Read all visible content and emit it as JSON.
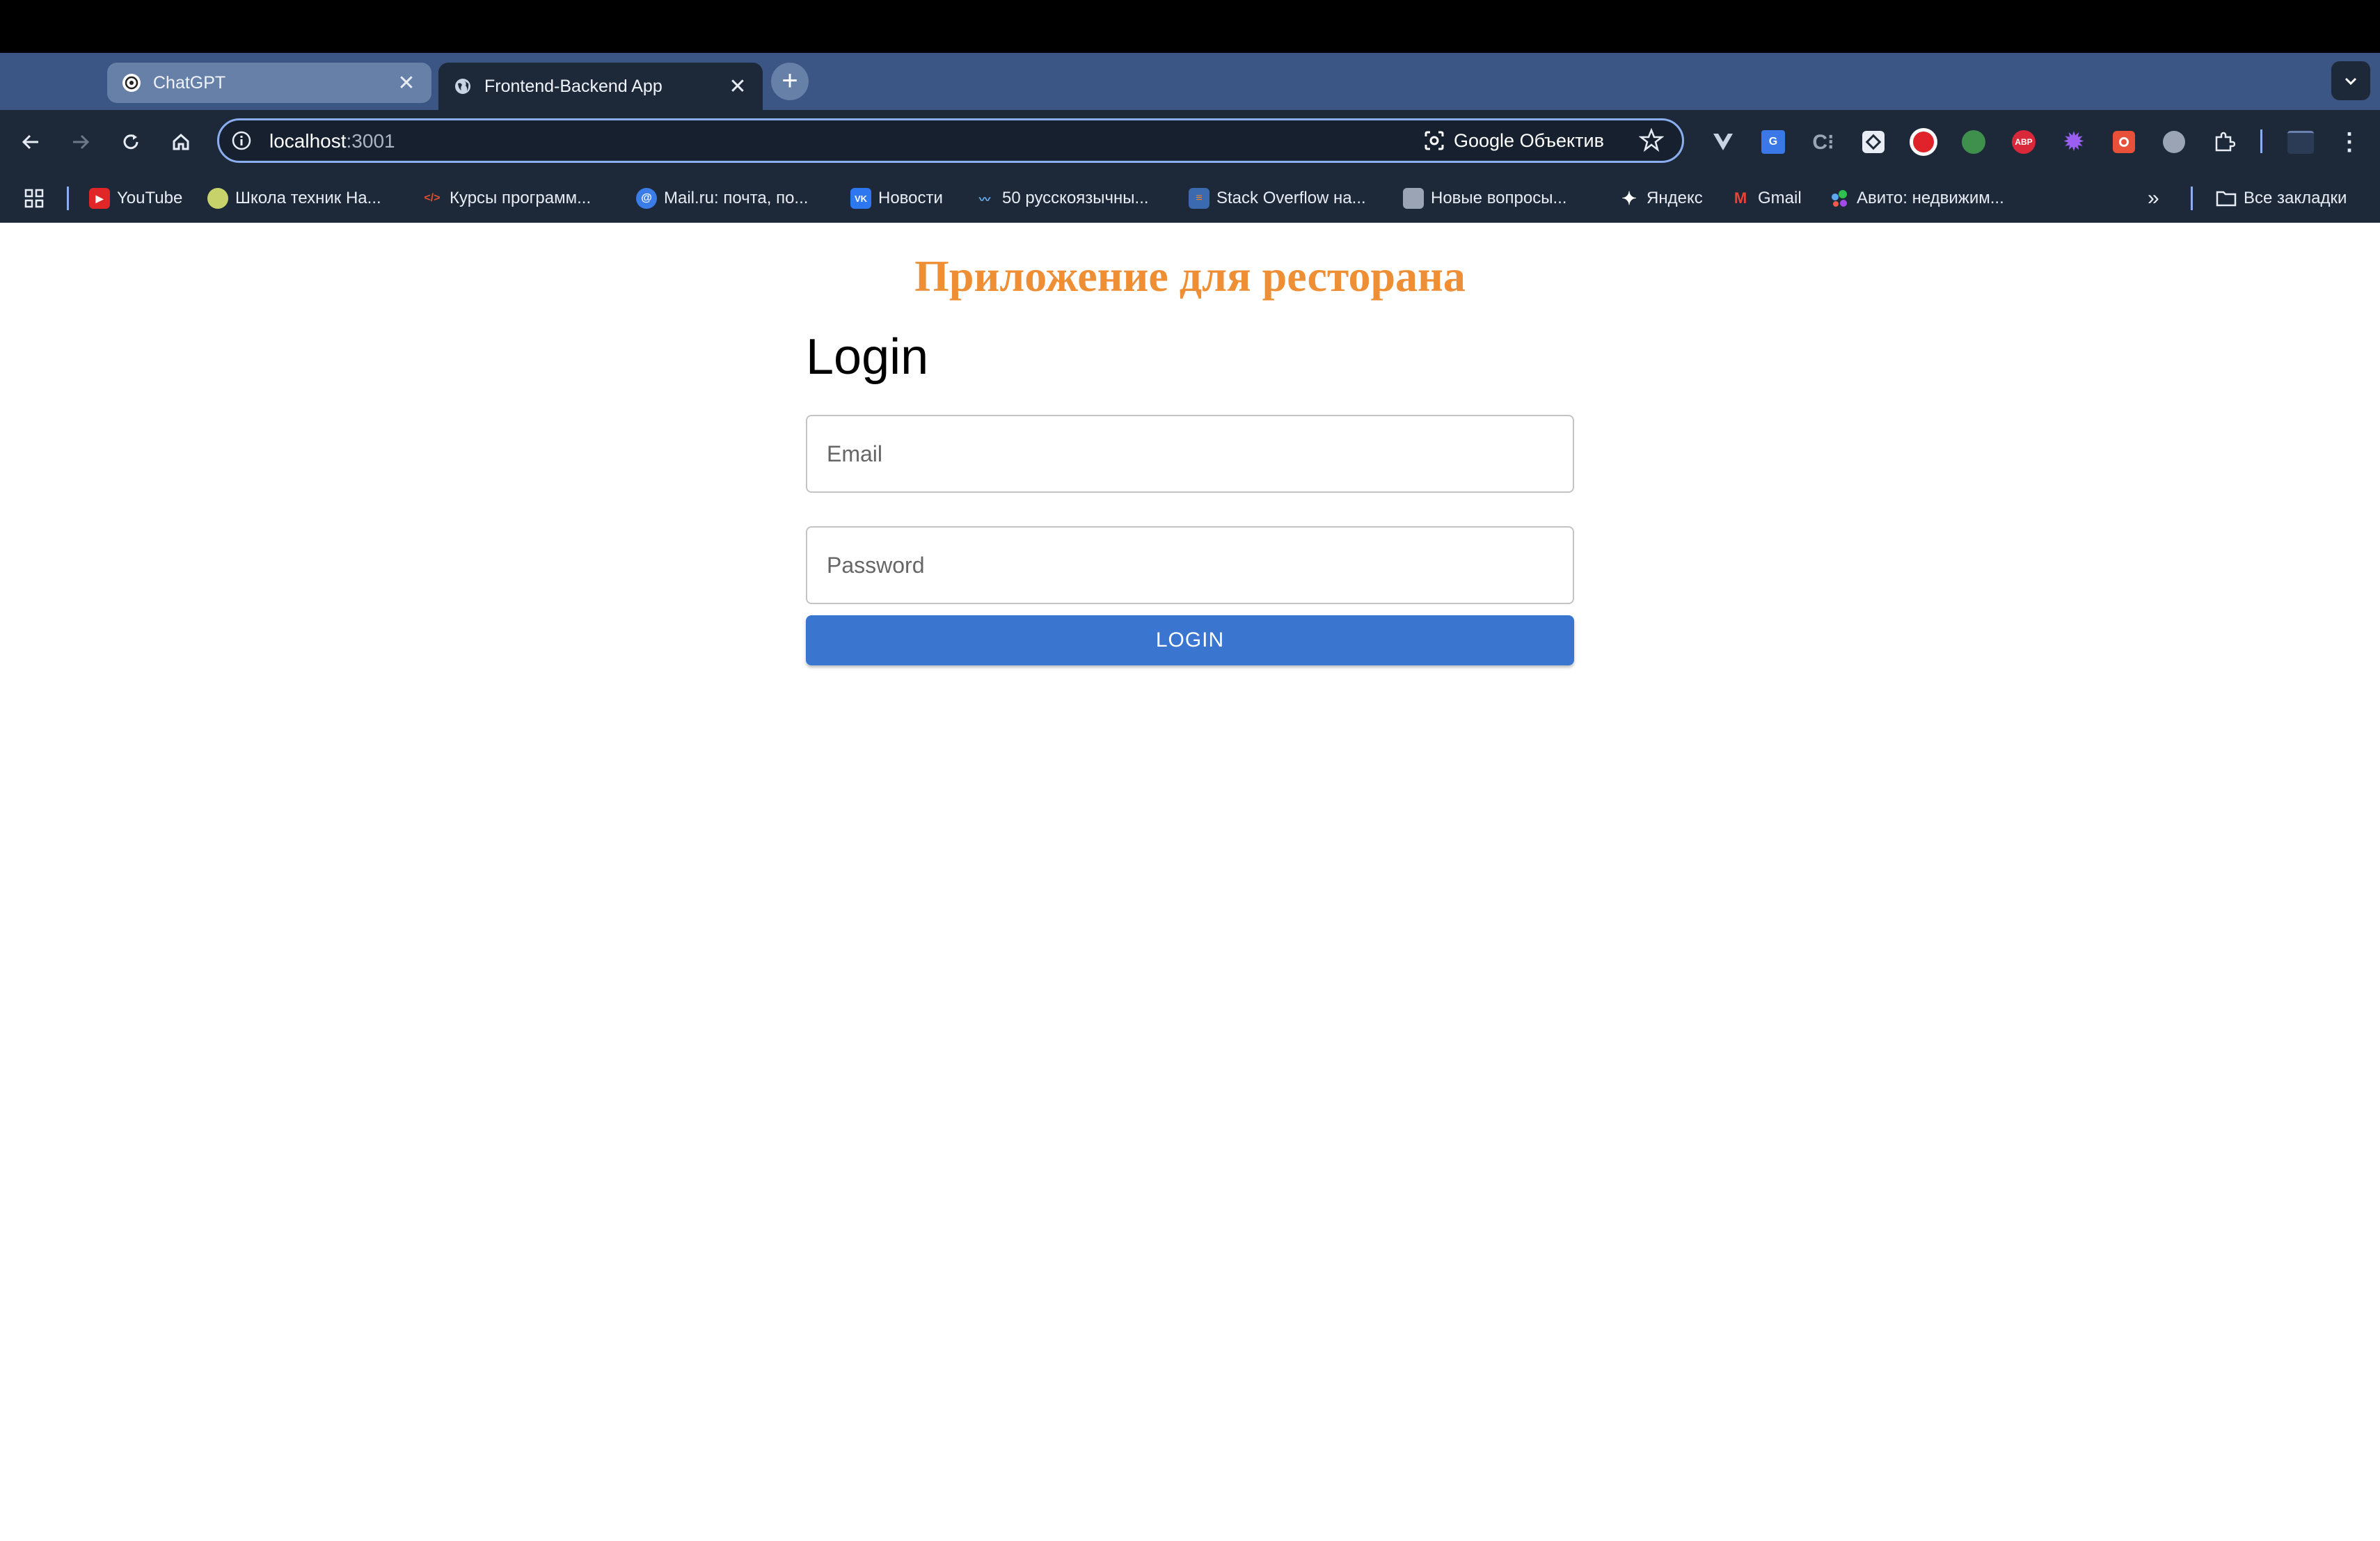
{
  "browser": {
    "tabs": [
      {
        "label": "ChatGPT",
        "favicon": "chatgpt-icon",
        "active": false
      },
      {
        "label": "Frontend-Backend App",
        "favicon": "globe-icon",
        "active": true
      }
    ],
    "address": {
      "host": "localhost",
      "port": ":3001",
      "lens_label": "Google Объектив"
    },
    "bookmarks": [
      {
        "label": "YouTube",
        "icon": "youtube-icon"
      },
      {
        "label": "Школа техник На...",
        "icon": "school-icon"
      },
      {
        "label": "Курсы программ...",
        "icon": "code-icon"
      },
      {
        "label": "Mail.ru: почта, по...",
        "icon": "mail-ru-icon"
      },
      {
        "label": "Новости",
        "icon": "vk-icon"
      },
      {
        "label": "50 русскоязычны...",
        "icon": "wave-icon"
      },
      {
        "label": "Stack Overflow на...",
        "icon": "stackoverflow-icon"
      },
      {
        "label": "Новые вопросы...",
        "icon": "chat-icon"
      },
      {
        "label": "Яндекс",
        "icon": "yandex-star-icon"
      },
      {
        "label": "Gmail",
        "icon": "gmail-icon"
      },
      {
        "label": "Авито: недвижим...",
        "icon": "avito-icon"
      }
    ],
    "all_bookmarks_label": "Все закладки",
    "colors": {
      "tabstrip": "#3b5585",
      "toolbar": "#1d2939",
      "omnibox_border": "#8aaef0"
    }
  },
  "page": {
    "heading": "Приложение для ресторана",
    "login_title": "Login",
    "email_placeholder": "Email",
    "password_placeholder": "Password",
    "login_button": "LOGIN",
    "colors": {
      "heading": "#ee8e35",
      "button": "#3a76d0"
    }
  }
}
